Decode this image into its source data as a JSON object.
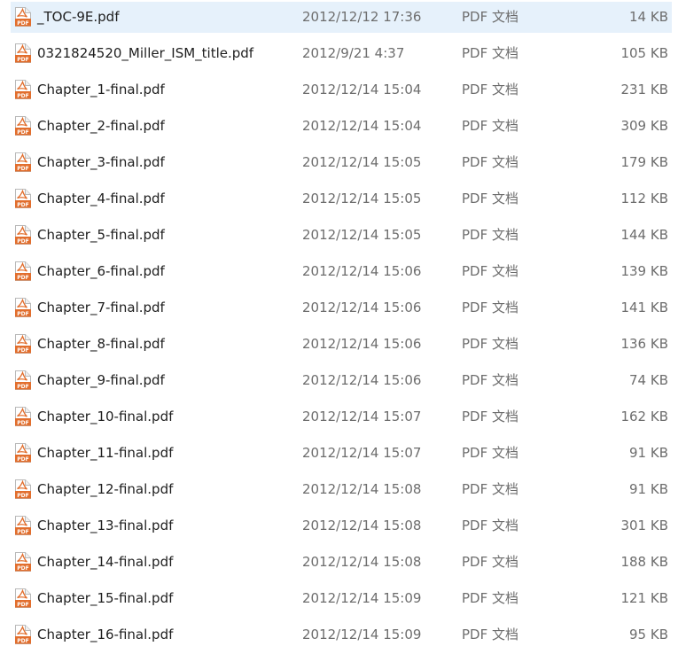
{
  "window": {
    "list_name": ""
  },
  "colors": {
    "selection": "#e6f1fb",
    "name_text": "#1e1e1e",
    "meta_text": "#6d6d6d",
    "pdf_icon": "#e26e2d"
  },
  "file_icon": "pdf-file-icon",
  "files": [
    {
      "name": "_TOC-9E.pdf",
      "date": "2012/12/12 17:36",
      "type": "PDF 文档",
      "size": "14 KB",
      "selected": true
    },
    {
      "name": "0321824520_Miller_ISM_title.pdf",
      "date": "2012/9/21 4:37",
      "type": "PDF 文档",
      "size": "105 KB",
      "selected": false
    },
    {
      "name": "Chapter_1-final.pdf",
      "date": "2012/12/14 15:04",
      "type": "PDF 文档",
      "size": "231 KB",
      "selected": false
    },
    {
      "name": "Chapter_2-final.pdf",
      "date": "2012/12/14 15:04",
      "type": "PDF 文档",
      "size": "309 KB",
      "selected": false
    },
    {
      "name": "Chapter_3-final.pdf",
      "date": "2012/12/14 15:05",
      "type": "PDF 文档",
      "size": "179 KB",
      "selected": false
    },
    {
      "name": "Chapter_4-final.pdf",
      "date": "2012/12/14 15:05",
      "type": "PDF 文档",
      "size": "112 KB",
      "selected": false
    },
    {
      "name": "Chapter_5-final.pdf",
      "date": "2012/12/14 15:05",
      "type": "PDF 文档",
      "size": "144 KB",
      "selected": false
    },
    {
      "name": "Chapter_6-final.pdf",
      "date": "2012/12/14 15:06",
      "type": "PDF 文档",
      "size": "139 KB",
      "selected": false
    },
    {
      "name": "Chapter_7-final.pdf",
      "date": "2012/12/14 15:06",
      "type": "PDF 文档",
      "size": "141 KB",
      "selected": false
    },
    {
      "name": "Chapter_8-final.pdf",
      "date": "2012/12/14 15:06",
      "type": "PDF 文档",
      "size": "136 KB",
      "selected": false
    },
    {
      "name": "Chapter_9-final.pdf",
      "date": "2012/12/14 15:06",
      "type": "PDF 文档",
      "size": "74 KB",
      "selected": false
    },
    {
      "name": "Chapter_10-final.pdf",
      "date": "2012/12/14 15:07",
      "type": "PDF 文档",
      "size": "162 KB",
      "selected": false
    },
    {
      "name": "Chapter_11-final.pdf",
      "date": "2012/12/14 15:07",
      "type": "PDF 文档",
      "size": "91 KB",
      "selected": false
    },
    {
      "name": "Chapter_12-final.pdf",
      "date": "2012/12/14 15:08",
      "type": "PDF 文档",
      "size": "91 KB",
      "selected": false
    },
    {
      "name": "Chapter_13-final.pdf",
      "date": "2012/12/14 15:08",
      "type": "PDF 文档",
      "size": "301 KB",
      "selected": false
    },
    {
      "name": "Chapter_14-final.pdf",
      "date": "2012/12/14 15:08",
      "type": "PDF 文档",
      "size": "188 KB",
      "selected": false
    },
    {
      "name": "Chapter_15-final.pdf",
      "date": "2012/12/14 15:09",
      "type": "PDF 文档",
      "size": "121 KB",
      "selected": false
    },
    {
      "name": "Chapter_16-final.pdf",
      "date": "2012/12/14 15:09",
      "type": "PDF 文档",
      "size": "95 KB",
      "selected": false
    }
  ]
}
